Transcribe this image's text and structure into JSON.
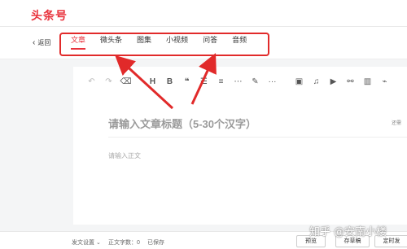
{
  "app": {
    "logo": "头条号"
  },
  "nav": {
    "back_label": "返回",
    "tabs": [
      {
        "label": "文章",
        "active": true
      },
      {
        "label": "微头条",
        "active": false
      },
      {
        "label": "图集",
        "active": false
      },
      {
        "label": "小视频",
        "active": false
      },
      {
        "label": "问答",
        "active": false
      },
      {
        "label": "音频",
        "active": false
      }
    ]
  },
  "toolbar": {
    "icons": [
      "undo-icon",
      "redo-icon",
      "eraser-icon",
      "heading-icon",
      "bold-icon",
      "quote-icon",
      "ordered-list-icon",
      "unordered-list-icon",
      "divider-icon",
      "text-color-icon",
      "more-icon",
      "image-icon",
      "audio-icon",
      "video-icon",
      "link-icon",
      "chart-icon",
      "attachment-icon"
    ]
  },
  "editor": {
    "title_placeholder": "请输入文章标题（5-30个汉字）",
    "side_note": "还需",
    "body_placeholder": "请输入正文"
  },
  "footer": {
    "settings_label": "发文设置",
    "word_count_label": "正文字数：0",
    "saved_label": "已保存",
    "preview_button": "预览",
    "draft_button": "存草稿",
    "schedule_button": "定时发"
  },
  "watermark": "知乎 @安南小楼",
  "colors": {
    "accent": "#e8323c",
    "annotation": "#e12a2a"
  }
}
